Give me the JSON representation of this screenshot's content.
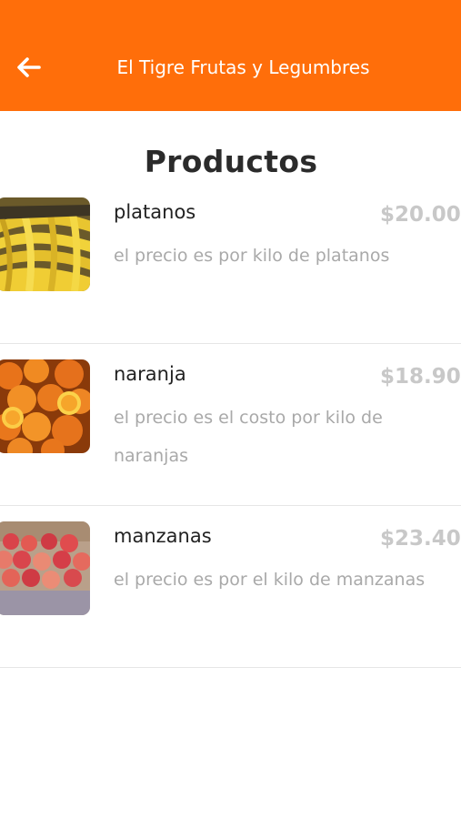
{
  "header": {
    "title": "El Tigre Frutas y Legumbres",
    "back_icon": "arrow-left-icon",
    "background_color": "#ff6e0a"
  },
  "page": {
    "title": "Productos"
  },
  "products": [
    {
      "name": "platanos",
      "price": "$20.00",
      "description": "el precio es por kilo de platanos",
      "image": "bananas"
    },
    {
      "name": "naranja",
      "price": "$18.90",
      "description": "el precio es el costo por kilo de naranjas",
      "image": "oranges"
    },
    {
      "name": "manzanas",
      "price": "$23.40",
      "description": "el precio es por el kilo de manzanas",
      "image": "apples"
    }
  ]
}
